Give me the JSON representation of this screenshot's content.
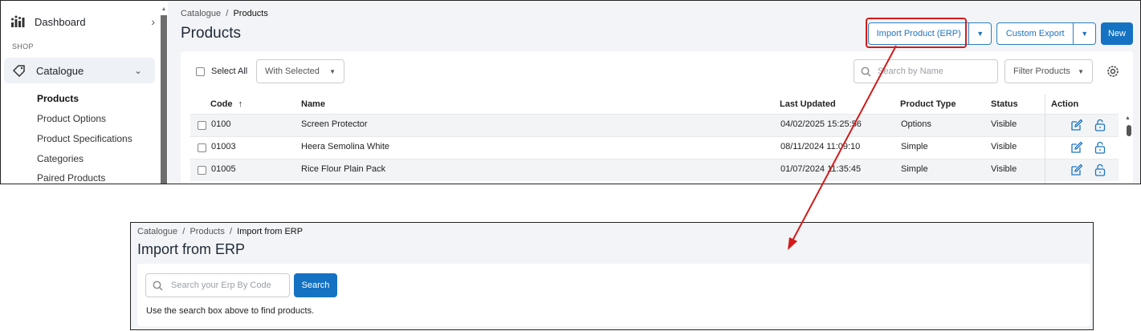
{
  "sidebar": {
    "dashboard_label": "Dashboard",
    "section_label": "SHOP",
    "catalogue_label": "Catalogue",
    "sub_items": [
      "Products",
      "Product Options",
      "Product Specifications",
      "Categories",
      "Paired Products"
    ]
  },
  "products_page": {
    "breadcrumb": [
      "Catalogue",
      "Products"
    ],
    "title": "Products",
    "buttons": {
      "import_erp": "Import Product (ERP)",
      "custom_export": "Custom Export",
      "new": "New"
    },
    "select_all_label": "Select All",
    "with_selected": "With Selected",
    "search_placeholder": "Search by Name",
    "filter_label": "Filter Products",
    "columns": [
      "Code",
      "Name",
      "Last Updated",
      "Product Type",
      "Status",
      "Action"
    ],
    "sort_indicator": "↑",
    "rows": [
      {
        "code": "0100",
        "name": "Screen Protector",
        "updated": "04/02/2025 15:25:56",
        "type": "Options",
        "status": "Visible"
      },
      {
        "code": "01003",
        "name": "Heera Semolina White",
        "updated": "08/11/2024 11:09:10",
        "type": "Simple",
        "status": "Visible"
      },
      {
        "code": "01005",
        "name": "Rice Flour Plain Pack",
        "updated": "01/07/2024 11:35:45",
        "type": "Simple",
        "status": "Visible"
      }
    ]
  },
  "import_page": {
    "breadcrumb": [
      "Catalogue",
      "Products",
      "Import from ERP"
    ],
    "title": "Import from ERP",
    "search_placeholder": "Search your Erp By Code",
    "search_button": "Search",
    "hint": "Use the search box above to find products."
  },
  "colors": {
    "primary": "#1572c2",
    "highlight": "#d41a1a",
    "page_bg": "#f3f4f7"
  }
}
